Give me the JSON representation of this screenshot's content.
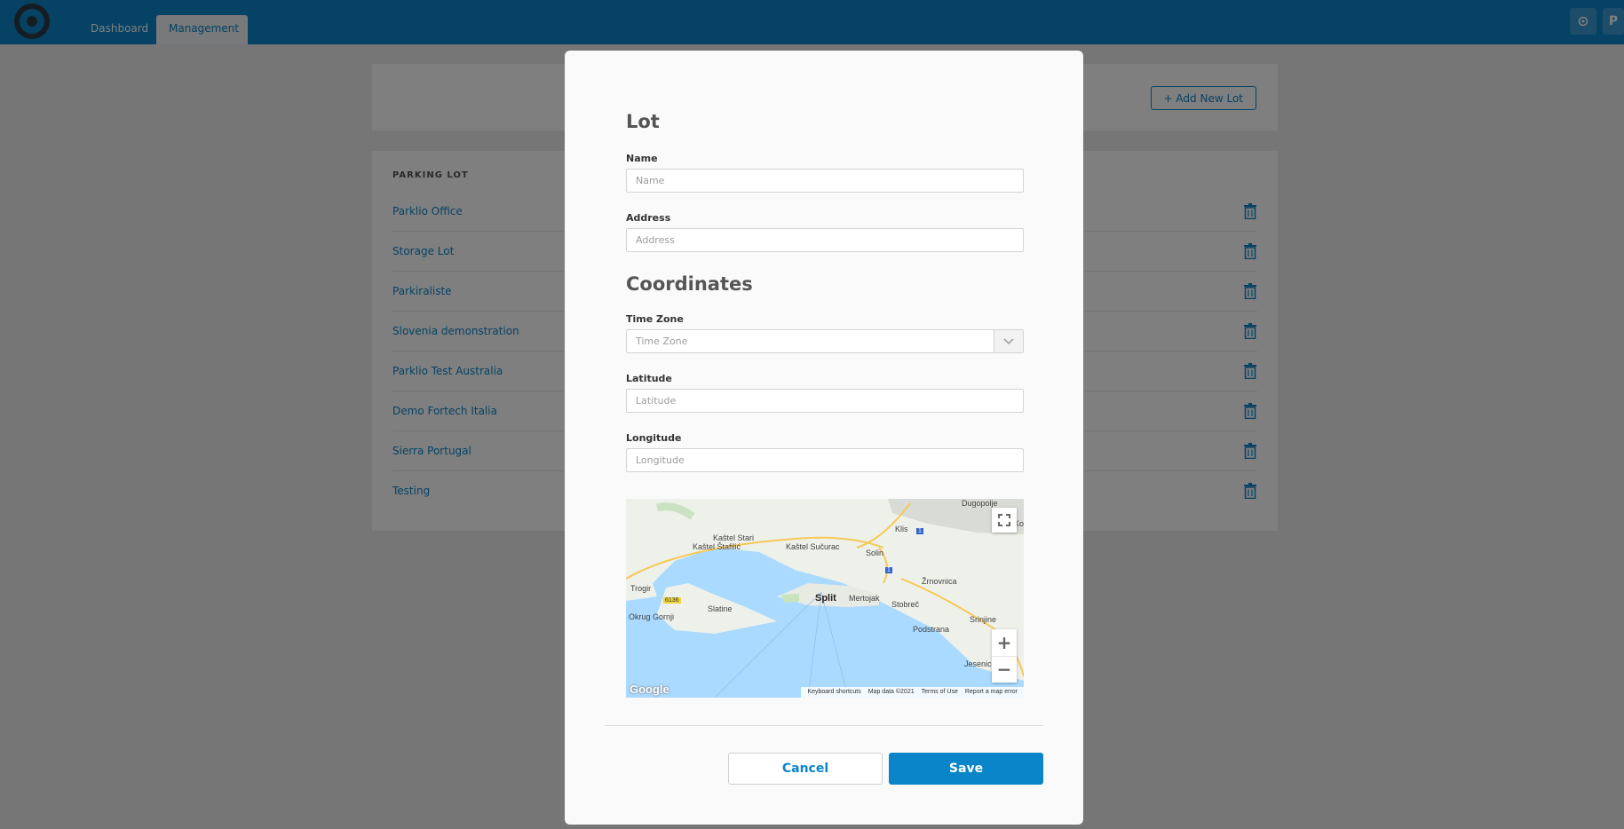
{
  "nav": {
    "tabs": [
      {
        "label": "Dashboard",
        "active": false
      },
      {
        "label": "Management",
        "active": true
      }
    ],
    "user_initial": "P",
    "settings_icon": "gear-icon",
    "accent_color": "#0a85c9"
  },
  "page": {
    "add_lot_label": "+ Add New Lot",
    "list_header": "PARKING LOT",
    "lots": [
      "Parklio Office",
      "Storage Lot",
      "Parkiraliste",
      "Slovenia demonstration",
      "Parklio Test Australia",
      "Demo Fortech Italia",
      "Sierra Portugal",
      "Testing"
    ]
  },
  "modal": {
    "lot_title": "Lot",
    "name_label": "Name",
    "name_placeholder": "Name",
    "address_label": "Address",
    "address_placeholder": "Address",
    "coordinates_title": "Coordinates",
    "timezone_label": "Time Zone",
    "timezone_placeholder": "Time Zone",
    "latitude_label": "Latitude",
    "latitude_placeholder": "Latitude",
    "longitude_label": "Longitude",
    "longitude_placeholder": "Longitude",
    "cancel_label": "Cancel",
    "save_label": "Save"
  },
  "map": {
    "places": [
      "Dugopolje",
      "Klis",
      "Kaštel Stari",
      "Kaštel Štafilić",
      "Kaštel Sučurac",
      "Solin",
      "Žrnovnica",
      "Trogir",
      "Split",
      "Mertojak",
      "Stobreč",
      "Slatine",
      "Okrug Gornji",
      "Srinjine",
      "Podstrana",
      "Jesenice",
      "Kor"
    ],
    "road_shields": [
      "1",
      "1",
      "6136"
    ],
    "google_label": "Google",
    "footer": [
      "Keyboard shortcuts",
      "Map data ©2021",
      "Terms of Use",
      "Report a map error"
    ],
    "zoom_in": "+",
    "zoom_out": "−"
  }
}
